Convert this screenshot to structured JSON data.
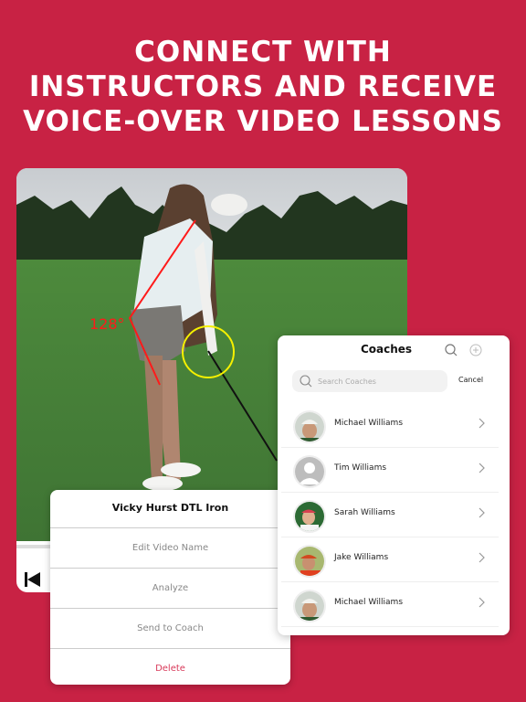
{
  "headline": {
    "lines": [
      "CONNECT WITH",
      "INSTRUCTORS AND RECEIVE",
      "VOICE-OVER VIDEO LESSONS"
    ]
  },
  "video": {
    "angle_label": "128°",
    "annotation_colors": {
      "angle_line": "#ff1a1a",
      "circle": "#f5f000"
    }
  },
  "action_sheet": {
    "title": "Vicky Hurst DTL Iron",
    "items": [
      {
        "label": "Edit Video Name"
      },
      {
        "label": "Analyze"
      },
      {
        "label": "Send to Coach"
      },
      {
        "label": "Delete",
        "destructive": true
      }
    ]
  },
  "coaches_panel": {
    "title": "Coaches",
    "search_placeholder": "Search Coaches",
    "search_value": "",
    "cancel_label": "Cancel",
    "header_icons": [
      "search-icon",
      "add-icon"
    ],
    "coaches": [
      {
        "name": "Michael Williams",
        "avatar": "photo"
      },
      {
        "name": "Tim Williams",
        "avatar": "placeholder"
      },
      {
        "name": "Sarah Williams",
        "avatar": "photo"
      },
      {
        "name": "Jake Williams",
        "avatar": "photo"
      },
      {
        "name": "Michael Williams",
        "avatar": "photo"
      }
    ]
  },
  "colors": {
    "background": "#c82244",
    "delete": "#d83a5a"
  }
}
